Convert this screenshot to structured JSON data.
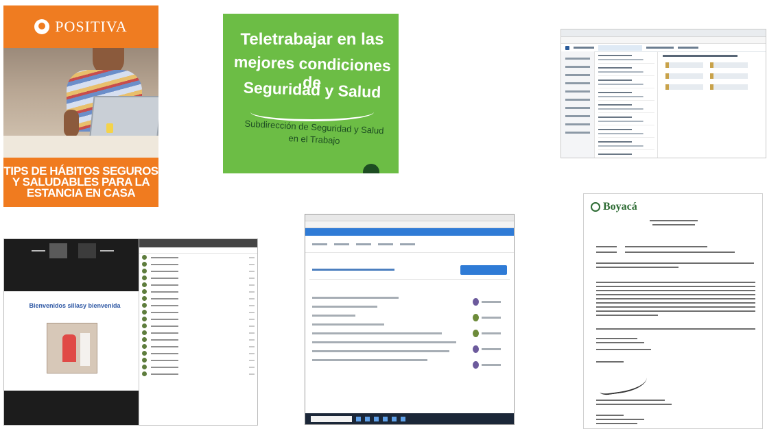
{
  "card_positiva": {
    "brand": "POSITIVA",
    "tips_line1": "TIPS DE HÁBITOS SEGUROS",
    "tips_line2": "Y SALUDABLES PARA LA",
    "tips_line3": "ESTANCIA EN CASA"
  },
  "card_teletrabajo": {
    "title_line1": "Teletrabajar en las",
    "title_line2": "mejores condiciones de",
    "title_line3": "Seguridad y Salud",
    "subtitle_line1": "Subdirección de Seguridad y Salud",
    "subtitle_line2": "en el Trabajo"
  },
  "card_video": {
    "welcome": "Bienvenidos sillasy bienvenida"
  },
  "card_letter": {
    "header": "Boyacá"
  },
  "colors": {
    "positiva_orange": "#f07b1f",
    "teletrabajo_green": "#6cbd45",
    "platform_blue": "#2f7bd6",
    "boyaca_green": "#2d6b33"
  }
}
